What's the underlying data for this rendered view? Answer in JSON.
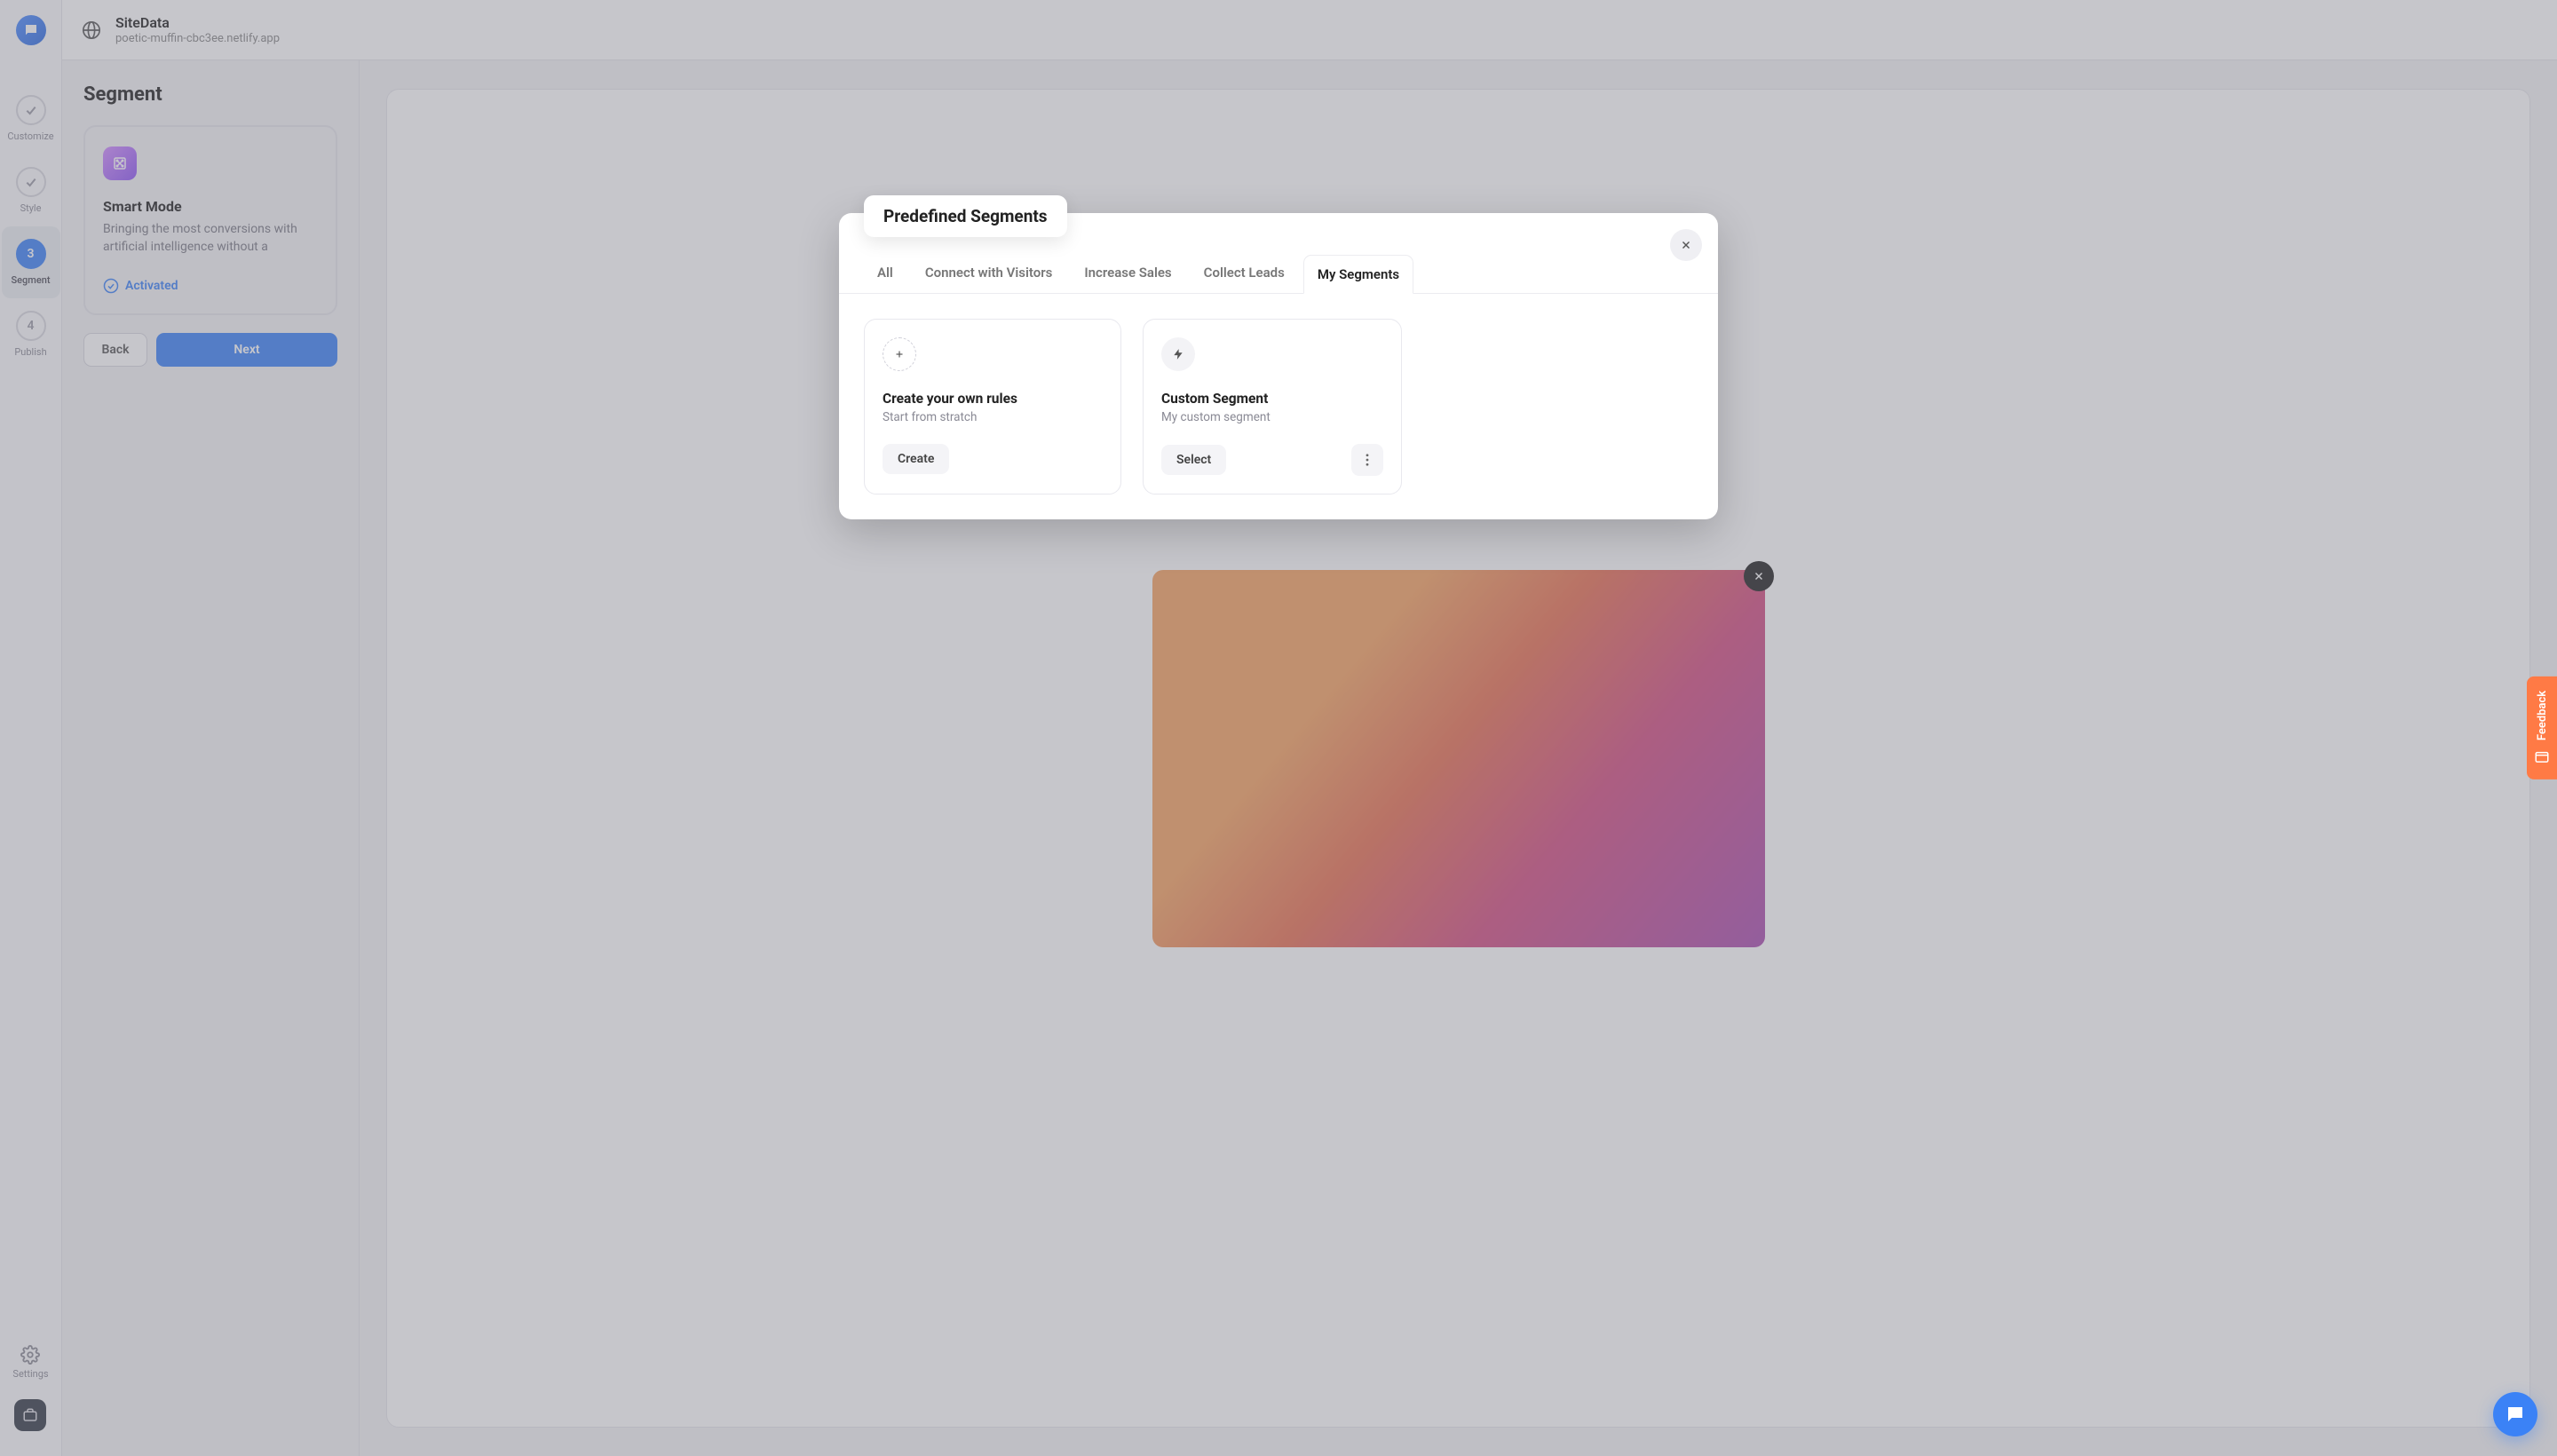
{
  "rail": {
    "steps": [
      {
        "label": "Customize"
      },
      {
        "label": "Style"
      },
      {
        "number": "3",
        "label": "Segment"
      },
      {
        "number": "4",
        "label": "Publish"
      }
    ],
    "settings_label": "Settings"
  },
  "topbar": {
    "title": "SiteData",
    "subtitle": "poetic-muffin-cbc3ee.netlify.app"
  },
  "side": {
    "heading": "Segment",
    "card": {
      "title": "Smart Mode",
      "desc": "Bringing the most conversions with artificial intelligence without a",
      "status": "Activated"
    },
    "back": "Back",
    "next": "Next"
  },
  "modal": {
    "title": "Predefined Segments",
    "tabs": {
      "all": "All",
      "connect": "Connect with Visitors",
      "sales": "Increase Sales",
      "leads": "Collect Leads",
      "mine": "My Segments"
    },
    "cards": {
      "create": {
        "title": "Create your own rules",
        "sub": "Start from stratch",
        "btn": "Create"
      },
      "custom": {
        "title": "Custom Segment",
        "sub": "My custom segment",
        "btn": "Select"
      }
    }
  },
  "feedback": {
    "label": "Feedback"
  }
}
